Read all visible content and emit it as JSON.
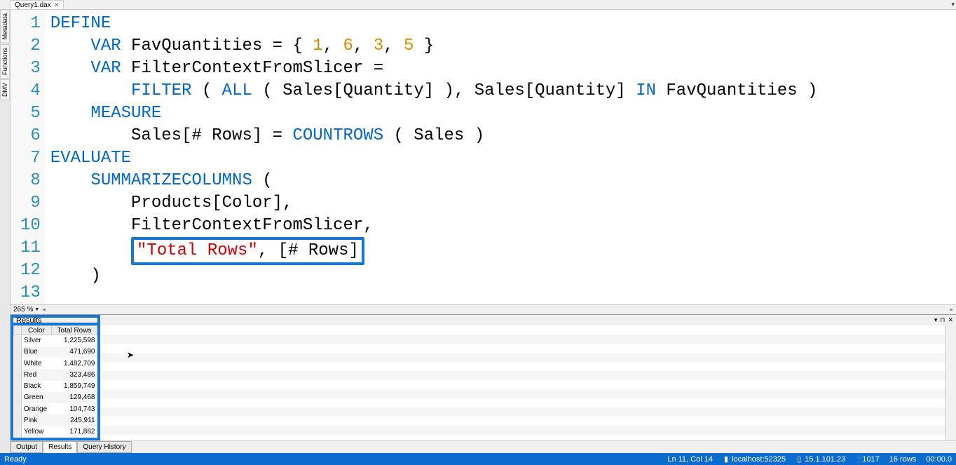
{
  "tab": {
    "title": "Query1.dax"
  },
  "sideTabs": {
    "metadata": "Metadata",
    "functions": "Functions",
    "dmv": "DMV"
  },
  "code": {
    "l1": "DEFINE",
    "l2a": "    VAR",
    "l2b": " FavQuantities = { ",
    "l2n1": "1",
    "l2c": ", ",
    "l2n2": "6",
    "l2n3": "3",
    "l2n4": "5",
    "l2d": " }",
    "l3a": "    VAR",
    "l3b": " FilterContextFromSlicer =",
    "l4a": "        ",
    "l4f1": "FILTER",
    "l4b": " ( ",
    "l4f2": "ALL",
    "l4c": " ( Sales[Quantity] ), Sales[Quantity] ",
    "l4k": "IN",
    "l4d": " FavQuantities )",
    "l5a": "    ",
    "l5k": "MEASURE",
    "l6a": "        Sales[# Rows] = ",
    "l6f": "COUNTROWS",
    "l6b": " ( Sales )",
    "l7": "EVALUATE",
    "l8a": "    ",
    "l8f": "SUMMARIZECOLUMNS",
    "l8b": " (",
    "l9": "        Products[Color],",
    "l10": "        FilterContextFromSlicer,",
    "l11a": "        ",
    "l11s": "\"Total Rows\"",
    "l11b": ", [# Rows]",
    "l12": "    )"
  },
  "zoom": "265 %",
  "results": {
    "title": "Results",
    "headers": {
      "color": "Color",
      "total": "Total Rows"
    },
    "rows": [
      {
        "c": "Silver",
        "t": "1,225,598"
      },
      {
        "c": "Blue",
        "t": "471,690"
      },
      {
        "c": "White",
        "t": "1,482,709"
      },
      {
        "c": "Red",
        "t": "323,486"
      },
      {
        "c": "Black",
        "t": "1,859,749"
      },
      {
        "c": "Green",
        "t": "129,468"
      },
      {
        "c": "Orange",
        "t": "104,743"
      },
      {
        "c": "Pink",
        "t": "245,911"
      },
      {
        "c": "Yellow",
        "t": "171,882"
      }
    ]
  },
  "bottomTabs": {
    "output": "Output",
    "results": "Results",
    "history": "Query History"
  },
  "status": {
    "ready": "Ready",
    "pos": "Ln 11, Col 14",
    "server": "localhost:52325",
    "version": "15.1.101.23",
    "users": "1017",
    "rows": "16 rows",
    "time": "00:00.0"
  }
}
